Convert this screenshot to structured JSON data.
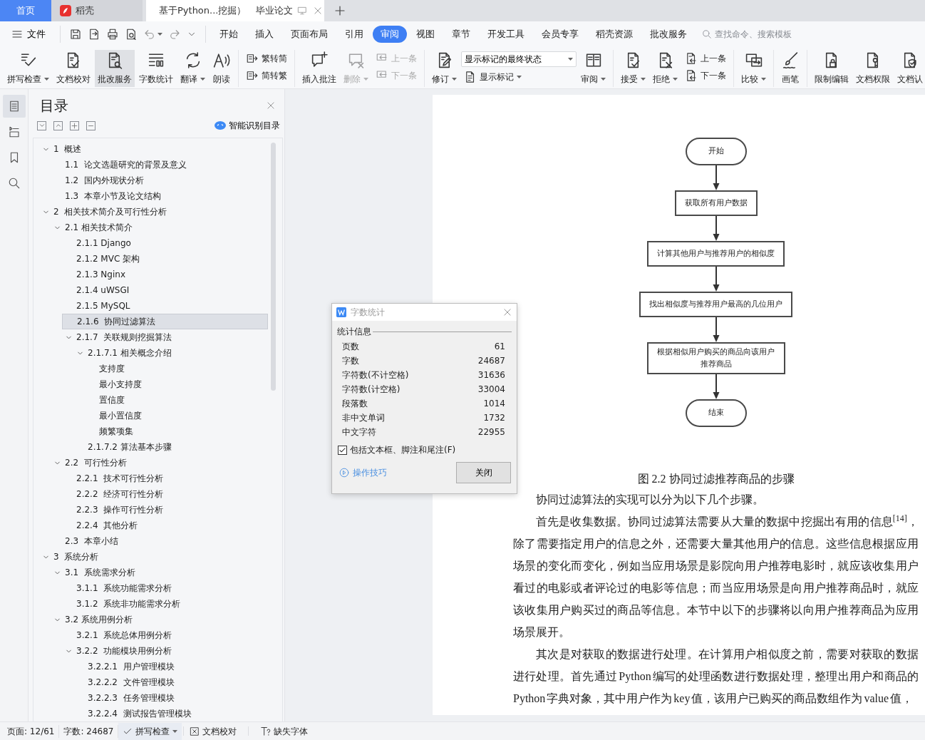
{
  "tabs": [
    {
      "kind": "home",
      "label": "首页",
      "selected": false
    },
    {
      "kind": "app",
      "label": "稻壳",
      "selected": false
    },
    {
      "kind": "document",
      "label": "基于Python...挖掘）",
      "tag": "毕业论文",
      "selected": true
    }
  ],
  "menu": {
    "file": "文件",
    "tabs": [
      {
        "label": "开始",
        "selected": false
      },
      {
        "label": "插入",
        "selected": false
      },
      {
        "label": "页面布局",
        "selected": false
      },
      {
        "label": "引用",
        "selected": false
      },
      {
        "label": "审阅",
        "selected": true
      },
      {
        "label": "视图",
        "selected": false
      },
      {
        "label": "章节",
        "selected": false
      },
      {
        "label": "开发工具",
        "selected": false
      },
      {
        "label": "会员专享",
        "selected": false
      },
      {
        "label": "稻壳资源",
        "selected": false
      },
      {
        "label": "批改服务",
        "selected": false
      }
    ],
    "search": {
      "placeholder": "查找命令、搜索模板"
    }
  },
  "ribbon": [
    {
      "items": [
        {
          "kind": "big",
          "label": "拼写检查",
          "dropdown": true,
          "disabled": false,
          "selected": false
        },
        {
          "kind": "big",
          "label": "文档校对",
          "dropdown": false,
          "disabled": false,
          "selected": false
        },
        {
          "kind": "big",
          "label": "批改服务",
          "dropdown": false,
          "disabled": false,
          "selected": true
        },
        {
          "kind": "big",
          "label": "字数统计",
          "dropdown": false,
          "disabled": false,
          "selected": false
        },
        {
          "kind": "big",
          "label": "翻译",
          "dropdown": true,
          "disabled": false,
          "selected": false
        },
        {
          "kind": "big",
          "label": "朗读",
          "dropdown": false,
          "disabled": false,
          "selected": false
        }
      ]
    },
    {
      "items": [
        {
          "kind": "stack",
          "items": [
            {
              "kind": "small",
              "label": "繁转简",
              "dropdown": false,
              "disabled": false
            },
            {
              "kind": "small",
              "label": "简转繁",
              "dropdown": false,
              "disabled": false
            }
          ]
        }
      ]
    },
    {
      "items": [
        {
          "kind": "big",
          "label": "插入批注",
          "dropdown": false,
          "disabled": false,
          "selected": false
        },
        {
          "kind": "big",
          "label": "删除",
          "dropdown": true,
          "disabled": true,
          "selected": false
        },
        {
          "kind": "stack",
          "items": [
            {
              "kind": "small",
              "label": "上一条",
              "dropdown": false,
              "disabled": true
            },
            {
              "kind": "small",
              "label": "下一条",
              "dropdown": false,
              "disabled": true
            }
          ]
        }
      ]
    },
    {
      "items": [
        {
          "kind": "big",
          "label": "修订",
          "dropdown": true,
          "disabled": false,
          "selected": false
        },
        {
          "kind": "stack",
          "items": [
            {
              "kind": "select",
              "label": "显示标记的最终状态",
              "dropdown": true
            },
            {
              "kind": "small",
              "label": "显示标记",
              "dropdown": true,
              "disabled": false
            }
          ]
        },
        {
          "kind": "big",
          "label": "审阅",
          "dropdown": true,
          "disabled": false,
          "selected": false
        }
      ]
    },
    {
      "items": [
        {
          "kind": "big",
          "label": "接受",
          "dropdown": true,
          "disabled": false,
          "selected": false
        },
        {
          "kind": "big",
          "label": "拒绝",
          "dropdown": true,
          "disabled": false,
          "selected": false
        },
        {
          "kind": "stack",
          "items": [
            {
              "kind": "small",
              "label": "上一条",
              "dropdown": false,
              "disabled": false
            },
            {
              "kind": "small",
              "label": "下一条",
              "dropdown": false,
              "disabled": false
            }
          ]
        }
      ]
    },
    {
      "items": [
        {
          "kind": "big",
          "label": "比较",
          "dropdown": true,
          "disabled": false,
          "selected": false
        }
      ]
    },
    {
      "items": [
        {
          "kind": "big",
          "label": "画笔",
          "dropdown": false,
          "disabled": false,
          "selected": false
        }
      ]
    },
    {
      "items": [
        {
          "kind": "big",
          "label": "限制编辑",
          "dropdown": false,
          "disabled": false,
          "selected": false
        },
        {
          "kind": "big",
          "label": "文档权限",
          "dropdown": false,
          "disabled": false,
          "selected": false
        },
        {
          "kind": "big",
          "label": "文档认",
          "dropdown": false,
          "disabled": false,
          "selected": false
        }
      ]
    }
  ],
  "sidebar": {
    "items": [
      {
        "selected": true
      },
      {
        "selected": false
      },
      {
        "selected": false
      },
      {
        "selected": false
      }
    ]
  },
  "toc": {
    "title": "目录",
    "smart": "智能识别目录",
    "items": [
      {
        "label": "1  概述",
        "expanded": true,
        "selected": false,
        "children": [
          {
            "label": "1.1  论文选题研究的背景及意义",
            "selected": false
          },
          {
            "label": "1.2  国内外现状分析",
            "selected": false
          },
          {
            "label": "1.3  本章小节及论文结构",
            "selected": false
          }
        ]
      },
      {
        "label": "2  相关技术简介及可行性分析",
        "expanded": true,
        "selected": false,
        "children": [
          {
            "label": "2.1 相关技术简介",
            "expanded": true,
            "selected": false,
            "children": [
              {
                "label": "2.1.1 Django",
                "selected": false
              },
              {
                "label": "2.1.2 MVC 架构",
                "selected": false
              },
              {
                "label": "2.1.3 Nginx",
                "selected": false
              },
              {
                "label": "2.1.4 uWSGI",
                "selected": false
              },
              {
                "label": "2.1.5 MySQL",
                "selected": false
              },
              {
                "label": "2.1.6  协同过滤算法",
                "selected": true
              },
              {
                "label": "2.1.7  关联规则挖掘算法",
                "expanded": true,
                "selected": false,
                "children": [
                  {
                    "label": "2.1.7.1 相关概念介绍",
                    "expanded": true,
                    "selected": false,
                    "children": [
                      {
                        "label": "支持度",
                        "selected": false
                      },
                      {
                        "label": "最小支持度",
                        "selected": false
                      },
                      {
                        "label": "置信度",
                        "selected": false
                      },
                      {
                        "label": "最小置信度",
                        "selected": false
                      },
                      {
                        "label": "频繁项集",
                        "selected": false
                      }
                    ]
                  },
                  {
                    "label": "2.1.7.2 算法基本步骤",
                    "selected": false
                  }
                ]
              }
            ]
          },
          {
            "label": "2.2  可行性分析",
            "expanded": true,
            "selected": false,
            "children": [
              {
                "label": "2.2.1  技术可行性分析",
                "selected": false
              },
              {
                "label": "2.2.2  经济可行性分析",
                "selected": false
              },
              {
                "label": "2.2.3  操作可行性分析",
                "selected": false
              },
              {
                "label": "2.2.4  其他分析",
                "selected": false
              }
            ]
          },
          {
            "label": "2.3  本章小结",
            "selected": false
          }
        ]
      },
      {
        "label": "3  系统分析",
        "expanded": true,
        "selected": false,
        "children": [
          {
            "label": "3.1  系统需求分析",
            "expanded": true,
            "selected": false,
            "children": [
              {
                "label": "3.1.1  系统功能需求分析",
                "selected": false
              },
              {
                "label": "3.1.2  系统非功能需求分析",
                "selected": false
              }
            ]
          },
          {
            "label": "3.2 系统用例分析",
            "expanded": true,
            "selected": false,
            "children": [
              {
                "label": "3.2.1  系统总体用例分析",
                "selected": false
              },
              {
                "label": "3.2.2  功能模块用例分析",
                "expanded": true,
                "selected": false,
                "children": [
                  {
                    "label": "3.2.2.1  用户管理模块",
                    "selected": false
                  },
                  {
                    "label": "3.2.2.2  文件管理模块",
                    "selected": false
                  },
                  {
                    "label": "3.2.2.3  任务管理模块",
                    "selected": false
                  },
                  {
                    "label": "3.2.2.4  测试报告管理模块",
                    "selected": false
                  }
                ]
              }
            ]
          }
        ]
      }
    ]
  },
  "flowchart": {
    "nodes": [
      {
        "kind": "terminal",
        "label": "开始"
      },
      {
        "kind": "process",
        "label": "获取所有用户数据"
      },
      {
        "kind": "process",
        "label": "计算其他用户与推荐用户的相似度"
      },
      {
        "kind": "process",
        "label": "找出相似度与推荐用户最高的几位用户"
      },
      {
        "kind": "process",
        "label": "根据相似用户购买的商品向该用户推荐商品"
      },
      {
        "kind": "terminal",
        "label": "结束"
      }
    ],
    "caption": "图 2.2  协同过滤推荐商品的步骤"
  },
  "paragraphs": [
    "协同过滤算法的实现可以分为以下几个步骤。",
    "首先是收集数据。协同过滤算法需要从大量的数据中挖掘出有用的信息$^{[14]}$，除了需要指定用户的信息之外，还需要大量其他用户的信息。这些信息根据应用场景的变化而变化，例如当应用场景是影院向用户推荐电影时，就应该收集用户看过的电影或者评论过的电影等信息；而当应用场景是向用户推荐商品时，就应该收集用户购买过的商品等信息。本节中以下的步骤将以向用户推荐商品为应用场景展开。",
    "其次是对获取的数据进行处理。在计算用户相似度之前，需要对获取的数据进行处理。首先通过 Python 编写的处理函数进行数据处理，整理出用户和商品的 Python 字典对象，其中用户作为 key 值，该用户已购买的商品数组作为 value 值，"
  ],
  "dialog": {
    "title": "字数统计",
    "group": "统计信息",
    "rows": [
      {
        "label": "页数",
        "value": "61"
      },
      {
        "label": "字数",
        "value": "24687"
      },
      {
        "label": "字符数(不计空格)",
        "value": "31636"
      },
      {
        "label": "字符数(计空格)",
        "value": "33004"
      },
      {
        "label": "段落数",
        "value": "1014"
      },
      {
        "label": "非中文单词",
        "value": "1732"
      },
      {
        "label": "中文字符",
        "value": "22955"
      }
    ],
    "checkbox": {
      "label": "包括文本框、脚注和尾注(F)",
      "checked": true
    },
    "link": "操作技巧",
    "button": "关闭"
  },
  "status_bar": {
    "page": "页面: 12/61",
    "words": "字数: 24687",
    "spell": "拼写检查",
    "proof": "文档校对",
    "fonts": "缺失字体"
  }
}
